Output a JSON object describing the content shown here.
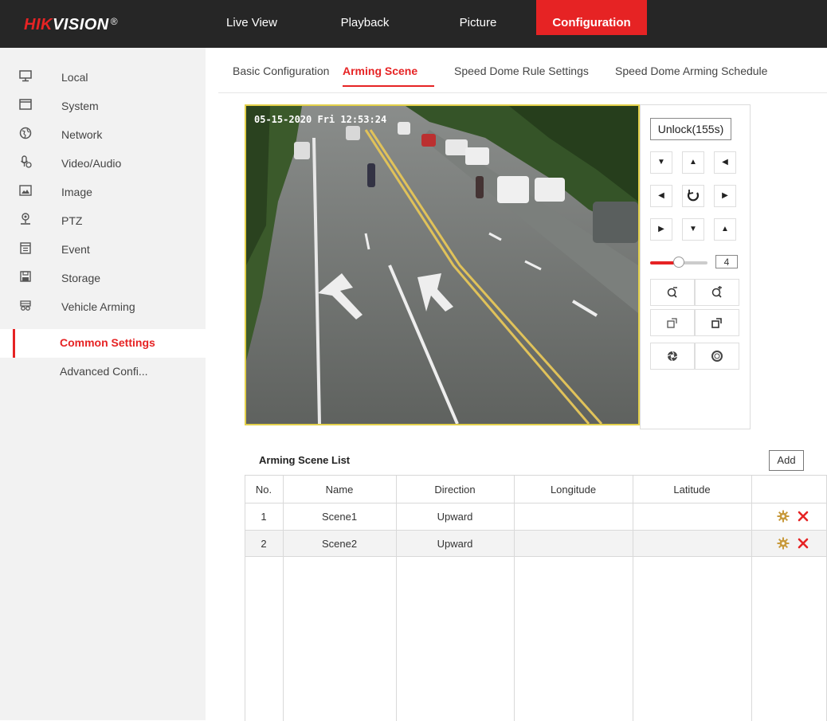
{
  "logo": {
    "brand_red": "HIK",
    "brand_white": "VISION",
    "reg": "®"
  },
  "nav": {
    "items": [
      {
        "label": "Live View"
      },
      {
        "label": "Playback"
      },
      {
        "label": "Picture"
      },
      {
        "label": "Configuration",
        "active": true
      }
    ]
  },
  "sidebar": {
    "items": [
      {
        "label": "Local",
        "icon": "monitor-icon"
      },
      {
        "label": "System",
        "icon": "window-icon"
      },
      {
        "label": "Network",
        "icon": "globe-icon"
      },
      {
        "label": "Video/Audio",
        "icon": "microphone-icon"
      },
      {
        "label": "Image",
        "icon": "image-icon"
      },
      {
        "label": "PTZ",
        "icon": "ptz-icon"
      },
      {
        "label": "Event",
        "icon": "calendar-icon"
      },
      {
        "label": "Storage",
        "icon": "disk-icon"
      },
      {
        "label": "Vehicle Arming",
        "icon": "vehicle-icon"
      }
    ],
    "subitems": [
      {
        "label": "Common Settings",
        "active": true
      },
      {
        "label": "Advanced Confi..."
      }
    ]
  },
  "tabs": {
    "items": [
      {
        "label": "Basic Configuration"
      },
      {
        "label": "Arming Scene",
        "active": true
      },
      {
        "label": "Speed Dome Rule Settings"
      },
      {
        "label": "Speed Dome Arming Schedule"
      }
    ]
  },
  "video": {
    "osd": "05-15-2020 Fri 12:53:24"
  },
  "ptz": {
    "unlock_label": "Unlock(155s)",
    "speed_value": "4",
    "speed_fraction": 0.5
  },
  "list": {
    "title": "Arming Scene List",
    "add_label": "Add",
    "headers": [
      "No.",
      "Name",
      "Direction",
      "Longitude",
      "Latitude"
    ],
    "rows": [
      {
        "no": "1",
        "name": "Scene1",
        "direction": "Upward",
        "longitude": "",
        "latitude": ""
      },
      {
        "no": "2",
        "name": "Scene2",
        "direction": "Upward",
        "longitude": "",
        "latitude": ""
      }
    ]
  },
  "colors": {
    "accent": "#e62324",
    "topbar": "#262626",
    "sidebar": "#f2f2f2",
    "gear": "#c89a3c"
  }
}
